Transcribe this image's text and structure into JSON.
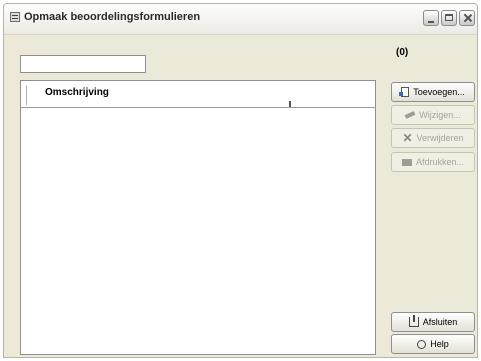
{
  "window": {
    "title": "Opmaak beoordelingsformulieren"
  },
  "filter": {
    "value": ""
  },
  "record_count": "(0)",
  "list": {
    "columns": [
      "Omschrijving"
    ],
    "rows": []
  },
  "buttons": {
    "add": "Toevoegen...",
    "edit": "Wijzigen...",
    "delete": "Verwijderen",
    "print": "Afdrukken...",
    "close": "Afsluiten",
    "help": "Help"
  },
  "icons": {
    "app": "form-icon",
    "add": "new-document-icon",
    "edit": "pencil-icon",
    "delete": "delete-x-icon",
    "print": "printer-icon",
    "close": "exit-door-icon",
    "help": "help-icon"
  }
}
